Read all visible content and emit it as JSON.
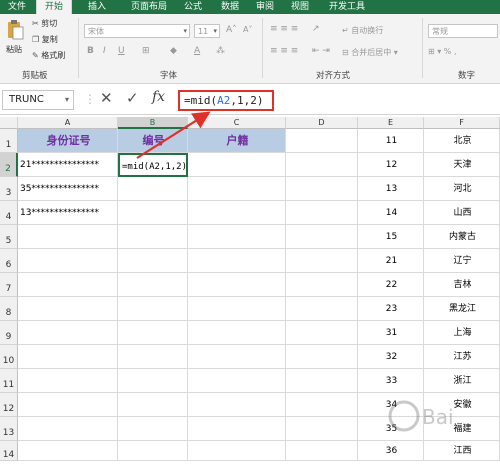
{
  "ribbon_tabs": [
    {
      "label": "文件"
    },
    {
      "label": "开始"
    },
    {
      "label": "插入"
    },
    {
      "label": "页面布局"
    },
    {
      "label": "公式"
    },
    {
      "label": "数据"
    },
    {
      "label": "审阅"
    },
    {
      "label": "视图"
    },
    {
      "label": "开发工具"
    }
  ],
  "ribbon": {
    "paste_label": "粘贴",
    "cut_label": "剪切",
    "copy_label": "复制",
    "format_painter_label": "格式刷",
    "clipboard_group": "剪贴板",
    "font_name": "宋体",
    "font_size": "11",
    "font_group": "字体",
    "wrap_text_label": "自动换行",
    "merge_center_label": "合并后居中",
    "alignment_group": "对齐方式",
    "number_format": "常规",
    "number_group": "数字"
  },
  "formula_bar": {
    "name_box": "TRUNC",
    "fx_label": "fx",
    "formula": "=mid(A2,1,2)"
  },
  "columns": [
    "A",
    "B",
    "C",
    "D",
    "E",
    "F"
  ],
  "rows": [
    "1",
    "2",
    "3",
    "4",
    "5",
    "6",
    "7",
    "8",
    "9",
    "10",
    "11",
    "12",
    "13",
    "14"
  ],
  "cells": {
    "A1": "身份证号",
    "B1": "编号",
    "C1": "户籍",
    "A2": "21***************",
    "B2": "=mid(A2,1,2)",
    "A3": "35***************",
    "A4": "13***************"
  },
  "code_table": [
    {
      "code": "11",
      "name": "北京"
    },
    {
      "code": "12",
      "name": "天津"
    },
    {
      "code": "13",
      "name": "河北"
    },
    {
      "code": "14",
      "name": "山西"
    },
    {
      "code": "15",
      "name": "内蒙古"
    },
    {
      "code": "21",
      "name": "辽宁"
    },
    {
      "code": "22",
      "name": "吉林"
    },
    {
      "code": "23",
      "name": "黑龙江"
    },
    {
      "code": "31",
      "name": "上海"
    },
    {
      "code": "32",
      "name": "江苏"
    },
    {
      "code": "33",
      "name": "浙江"
    },
    {
      "code": "34",
      "name": "安徽"
    },
    {
      "code": "35",
      "name": "福建"
    },
    {
      "code": "36",
      "name": "江西"
    }
  ],
  "colors": {
    "ribbon_green": "#217346",
    "header_fill": "#b8cce4",
    "header_text": "#7030a0",
    "annotation_red": "#e0302a"
  }
}
